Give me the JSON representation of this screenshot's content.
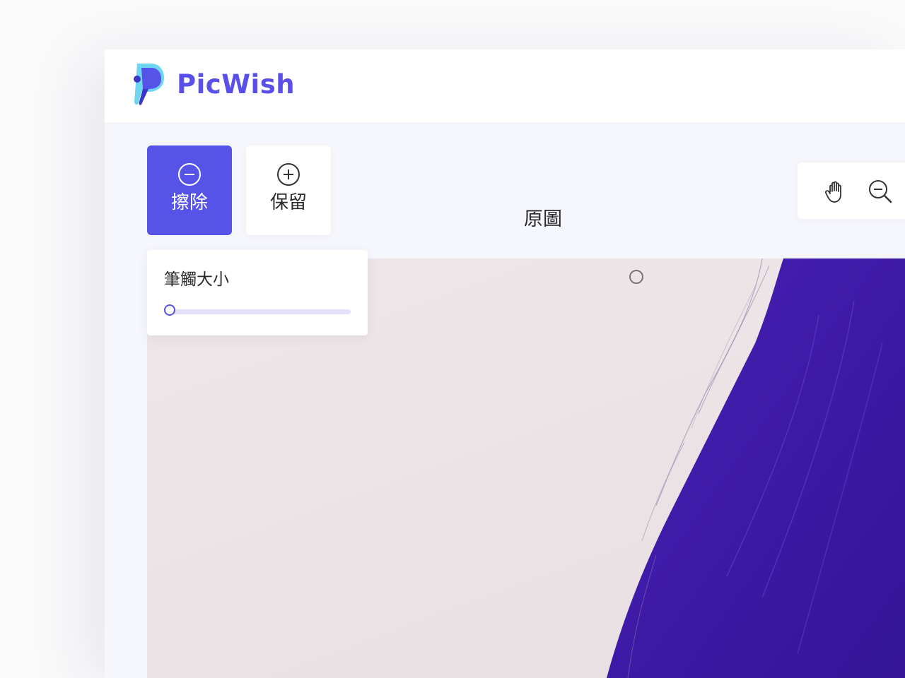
{
  "app": {
    "brand_name": "PicWish",
    "brand_color": "#5a4fe8",
    "accent_color": "#5654e8"
  },
  "modes": {
    "erase": {
      "label": "擦除",
      "icon": "minus-circle-icon",
      "active": true
    },
    "keep": {
      "label": "保留",
      "icon": "plus-circle-icon",
      "active": false
    }
  },
  "canvas": {
    "title": "原圖"
  },
  "toolbar": {
    "tools": [
      {
        "name": "pan",
        "icon": "hand-icon"
      },
      {
        "name": "zoom-out",
        "icon": "zoom-out-icon"
      }
    ]
  },
  "brush": {
    "title": "筆觸大小",
    "size_fraction": 0.0
  }
}
